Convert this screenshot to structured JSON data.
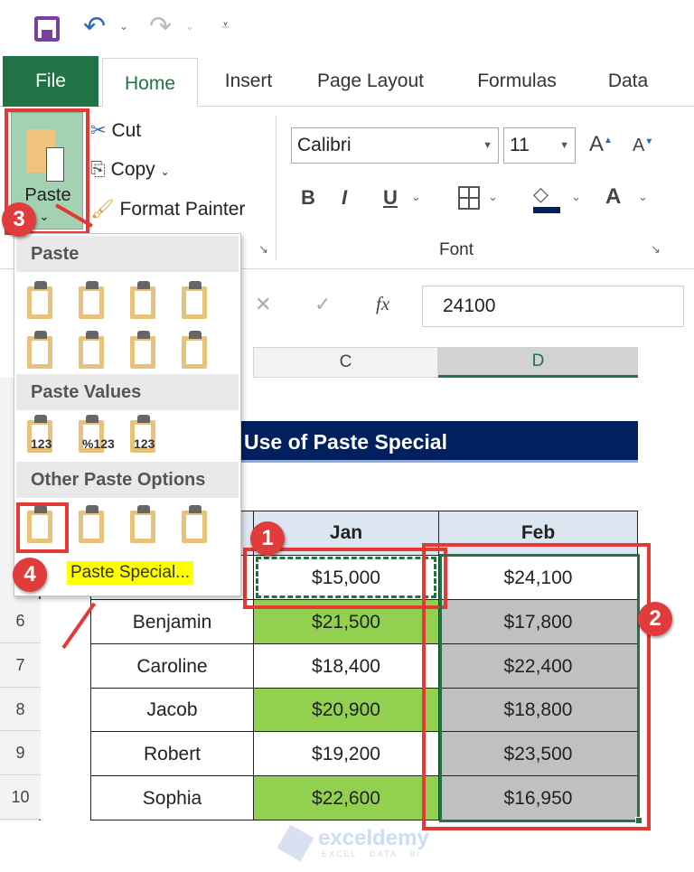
{
  "qat": {
    "icons": [
      "save-icon",
      "undo-icon",
      "redo-icon",
      "customize-icon"
    ]
  },
  "tabs": {
    "file": "File",
    "home": "Home",
    "insert": "Insert",
    "page_layout": "Page Layout",
    "formulas": "Formulas",
    "data": "Data"
  },
  "clipboard": {
    "paste": "Paste",
    "cut": "Cut",
    "copy": "Copy",
    "format_painter": "Format Painter"
  },
  "font": {
    "name": "Calibri",
    "size": "11",
    "group_label": "Font",
    "bold": "B",
    "italic": "I",
    "underline": "U",
    "grow": "A",
    "shrink": "A",
    "color": "A",
    "font_color": "#002060"
  },
  "formula_bar": {
    "cancel": "✕",
    "enter": "✓",
    "fx": "fx",
    "value": "24100"
  },
  "columns": [
    "C",
    "D"
  ],
  "rows": [
    "6",
    "7",
    "8",
    "9",
    "10"
  ],
  "sheet": {
    "title": "Use of Paste Special",
    "headers": [
      "Jan",
      "Feb"
    ],
    "data": [
      {
        "name": "",
        "jan": "$15,000",
        "feb": "$24,100"
      },
      {
        "name": "Benjamin",
        "jan": "$21,500",
        "feb": "$17,800"
      },
      {
        "name": "Caroline",
        "jan": "$18,400",
        "feb": "$22,400"
      },
      {
        "name": "Jacob",
        "jan": "$20,900",
        "feb": "$18,800"
      },
      {
        "name": "Robert",
        "jan": "$19,200",
        "feb": "$23,500"
      },
      {
        "name": "Sophia",
        "jan": "$22,600",
        "feb": "$16,950"
      }
    ],
    "green": "#92d050",
    "gray": "#c0c0c0",
    "title_bg": "#002060",
    "header_bg": "#dce6f1"
  },
  "paste_menu": {
    "paste": "Paste",
    "paste_values": "Paste Values",
    "other": "Other Paste Options",
    "paste_special": "Paste Special...",
    "paste_icons": [
      "paste-icon",
      "formulas-icon",
      "formulas-number-format-icon",
      "keep-source-formatting-icon",
      "no-borders-icon",
      "keep-column-widths-icon",
      "transpose-icon",
      "merge-conditional-formatting-icon"
    ],
    "values_glyphs": [
      "123",
      "%123",
      "123"
    ],
    "other_icons": [
      "formatting-icon",
      "paste-link-icon",
      "picture-icon",
      "linked-picture-icon"
    ]
  },
  "badges": [
    "1",
    "2",
    "3",
    "4"
  ],
  "watermark": {
    "brand": "exceldemy",
    "tagline": "EXCEL · DATA · BI"
  }
}
